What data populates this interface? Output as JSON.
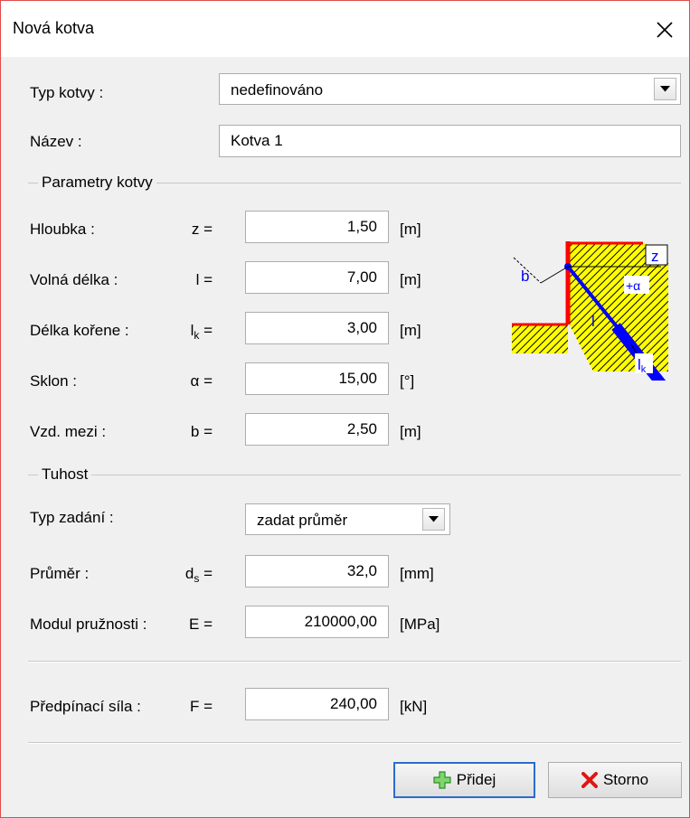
{
  "window": {
    "title": "Nová kotva"
  },
  "anchor_type": {
    "label": "Typ kotvy :",
    "value": "nedefinováno"
  },
  "name": {
    "label": "Název :",
    "value": "Kotva 1"
  },
  "parameters": {
    "group_title": "Parametry kotvy",
    "rows": [
      {
        "label": "Hloubka :",
        "symbol": "z",
        "value": "1,50",
        "unit": "[m]"
      },
      {
        "label": "Volná délka :",
        "symbol": "l",
        "value": "7,00",
        "unit": "[m]"
      },
      {
        "label": "Délka kořene :",
        "symbol": "l",
        "symbol_sub": "k",
        "value": "3,00",
        "unit": "[m]"
      },
      {
        "label": "Sklon :",
        "symbol": "α",
        "value": "15,00",
        "unit": "[°]"
      },
      {
        "label": "Vzd. mezi :",
        "symbol": "b",
        "value": "2,50",
        "unit": "[m]"
      }
    ]
  },
  "stiffness": {
    "group_title": "Tuhost",
    "input_type": {
      "label": "Typ zadání :",
      "value": "zadat průměr"
    },
    "diameter": {
      "label": "Průměr :",
      "symbol": "d",
      "symbol_sub": "s",
      "value": "32,0",
      "unit": "[mm]"
    },
    "modulus": {
      "label": "Modul pružnosti :",
      "symbol": "E",
      "value": "210000,00",
      "unit": "[MPa]"
    }
  },
  "prestress": {
    "label": "Předpínací síla :",
    "symbol": "F",
    "value": "240,00",
    "unit": "[kN]"
  },
  "diagram": {
    "labels": {
      "z": "z",
      "b": "b",
      "l": "l",
      "alpha": "+α",
      "lk": "l",
      "lk_sub": "k"
    }
  },
  "buttons": {
    "add": "Přidej",
    "cancel": "Storno"
  },
  "colors": {
    "hatch_fill": "#ffff00",
    "wall": "#ff0000",
    "anchor": "#0000ff"
  },
  "icons": {
    "close": "close-icon",
    "add": "plus-icon",
    "cancel": "x-icon",
    "dropdown": "dropdown-arrow-icon"
  }
}
